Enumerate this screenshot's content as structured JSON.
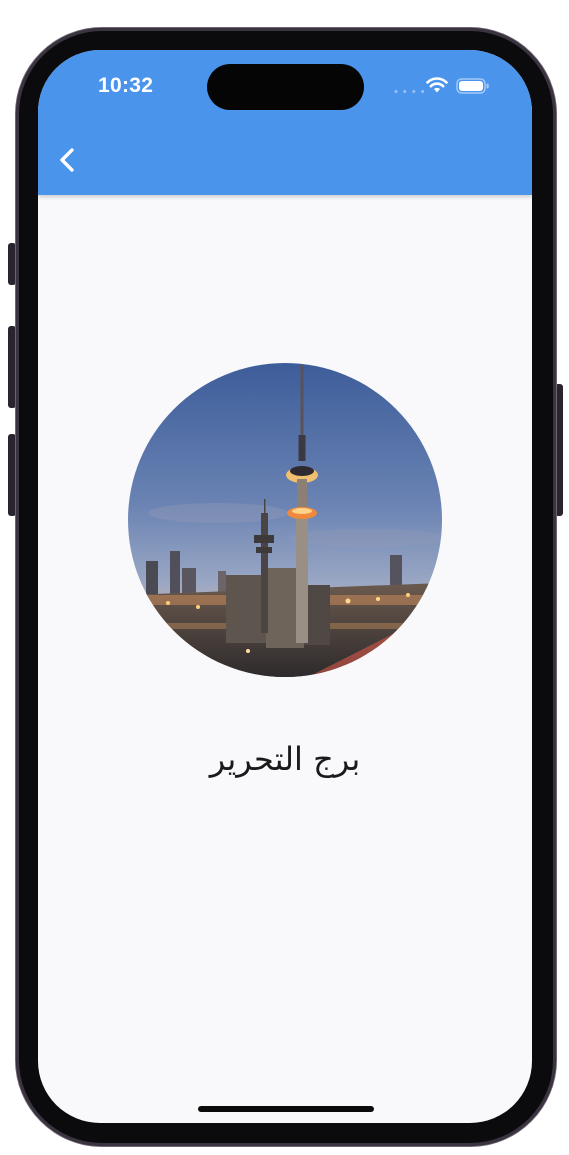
{
  "status_bar": {
    "time": "10:32",
    "signal_icon": "signal-dots-icon",
    "wifi_icon": "wifi-icon",
    "battery_icon": "battery-icon"
  },
  "app_bar": {
    "color": "#4a94ec",
    "back_icon": "chevron-left-icon"
  },
  "content": {
    "image": "Liberation Tower cityscape photo (circular)",
    "title": "برج التحرير"
  },
  "colors": {
    "accent": "#4a94ec",
    "background": "#f9f9fb",
    "text": "#1a1a1a"
  }
}
